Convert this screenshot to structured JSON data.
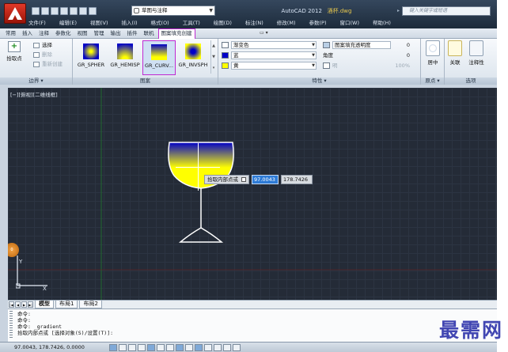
{
  "window": {
    "app_title": "AutoCAD 2012",
    "file_name": "酒杯.dwg",
    "workspace": "草图与注释",
    "search_placeholder": "键入关键字或短语"
  },
  "menubar": [
    "文件(F)",
    "编辑(E)",
    "视图(V)",
    "插入(I)",
    "格式(O)",
    "工具(T)",
    "绘图(D)",
    "标注(N)",
    "修改(M)",
    "参数(P)",
    "窗口(W)",
    "帮助(H)"
  ],
  "ribbon_tabs": [
    {
      "label": "常用"
    },
    {
      "label": "插入"
    },
    {
      "label": "注释"
    },
    {
      "label": "参数化"
    },
    {
      "label": "视图"
    },
    {
      "label": "管理"
    },
    {
      "label": "输出"
    },
    {
      "label": "插件"
    },
    {
      "label": "联机"
    },
    {
      "label": "图案填充创建",
      "active": true
    }
  ],
  "ribbon_tab_extra": "▭ ▾",
  "panels": {
    "boundary": {
      "title": "边界 ▾",
      "pick_label": "拾取点",
      "select_label": "选择",
      "remove_label": "删除",
      "recreate_label": "重新创建"
    },
    "pattern": {
      "title": "图案",
      "items": [
        {
          "label": "GR_SPHER",
          "colors": [
            "#0000c8",
            "#ffff00"
          ],
          "style": "radial"
        },
        {
          "label": "GR_HEMISP",
          "colors": [
            "#0000c8",
            "#ffff00"
          ],
          "style": "hemi"
        },
        {
          "label": "GR_CURV...",
          "colors": [
            "#0000c8",
            "#ffff00"
          ],
          "style": "curv",
          "selected": true
        },
        {
          "label": "GR_INVSPH",
          "colors": [
            "#0000c8",
            "#ffff00"
          ],
          "style": "inv"
        }
      ]
    },
    "properties": {
      "title": "特性 ▾",
      "type_value": "渐变色",
      "color1_value": "蓝",
      "color2_value": "黄",
      "transparency_label": "图案填充透明度",
      "transparency_value": "0",
      "angle_label": "角度",
      "angle_value": "0",
      "tint_value": "明",
      "tint_percent": "100%"
    },
    "origin": {
      "title": "原点 ▾",
      "center_label": "居中"
    },
    "options": {
      "title": "选项",
      "assoc_label": "关联",
      "annot_label": "注释性"
    }
  },
  "viewport": {
    "label": "[−][俯视][二维线框]",
    "dyn_prompt": "拾取内部点或",
    "dyn_x": "97.0043",
    "dyn_y": "178.7426",
    "ucs_x": "X",
    "ucs_y": "Y",
    "side_badge": "0"
  },
  "layout_tabs": [
    {
      "label": "模型",
      "active": true
    },
    {
      "label": "布局1"
    },
    {
      "label": "布局2"
    }
  ],
  "command_lines": [
    "命令:",
    "命令:",
    "命令: _gradient",
    "拾取内部点或 [选择对象(S)/设置(T)]:"
  ],
  "status": {
    "coords": "97.0043, 178.7426, 0.0000"
  },
  "watermark": "最需网"
}
